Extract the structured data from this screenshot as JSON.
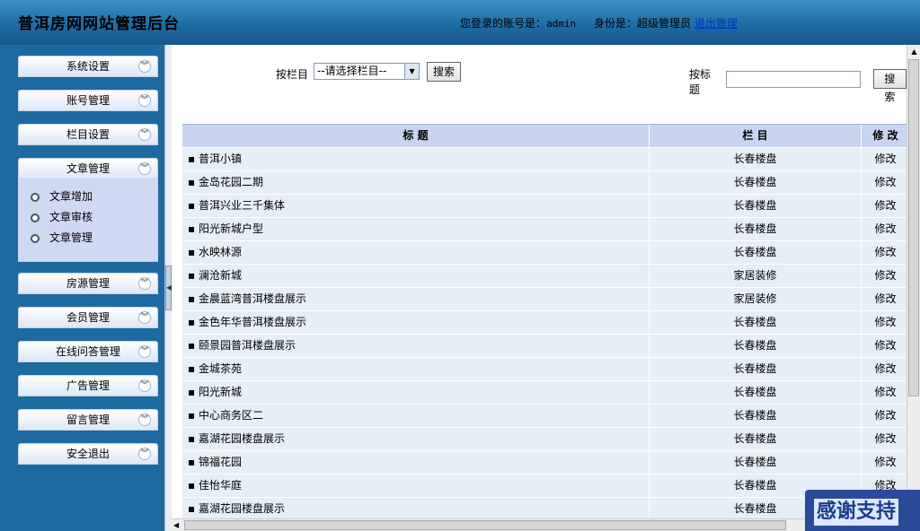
{
  "header": {
    "title": "普洱房网网站管理后台",
    "login_prefix": "您登录的账号是：",
    "account": "admin",
    "role_prefix": "身份是：",
    "role": "超级管理员",
    "logout_link": "退出管理"
  },
  "sidebar": {
    "menus": [
      {
        "label": "系统设置"
      },
      {
        "label": "账号管理"
      },
      {
        "label": "栏目设置"
      },
      {
        "label": "文章管理",
        "expanded": true,
        "items": [
          "文章增加",
          "文章审核",
          "文章管理"
        ]
      },
      {
        "label": "房源管理"
      },
      {
        "label": "会员管理"
      },
      {
        "label": "在线问答管理"
      },
      {
        "label": "广告管理"
      },
      {
        "label": "留言管理"
      },
      {
        "label": "安全退出"
      }
    ]
  },
  "search": {
    "category_label": "按栏目",
    "category_selected": "--请选择栏目--",
    "category_button": "搜索",
    "title_label": "按标题",
    "title_value": "",
    "title_button": "搜索"
  },
  "table": {
    "headers": [
      "标 题",
      "栏 目",
      "修 改"
    ],
    "rows": [
      {
        "title": "普洱小镇",
        "category": "长春楼盘",
        "action": "修改"
      },
      {
        "title": "金岛花园二期",
        "category": "长春楼盘",
        "action": "修改"
      },
      {
        "title": "普洱兴业三千集体",
        "category": "长春楼盘",
        "action": "修改"
      },
      {
        "title": "阳光新城户型",
        "category": "长春楼盘",
        "action": "修改"
      },
      {
        "title": "水映林源",
        "category": "长春楼盘",
        "action": "修改"
      },
      {
        "title": "澜沧新城",
        "category": "家居装修",
        "action": "修改"
      },
      {
        "title": "金晨蓝湾普洱楼盘展示",
        "category": "家居装修",
        "action": "修改"
      },
      {
        "title": "金色年华普洱楼盘展示",
        "category": "长春楼盘",
        "action": "修改"
      },
      {
        "title": "颐景园普洱楼盘展示",
        "category": "长春楼盘",
        "action": "修改"
      },
      {
        "title": "金城茶苑",
        "category": "长春楼盘",
        "action": "修改"
      },
      {
        "title": "阳光新城",
        "category": "长春楼盘",
        "action": "修改"
      },
      {
        "title": "中心商务区二",
        "category": "长春楼盘",
        "action": "修改"
      },
      {
        "title": "嘉湖花园楼盘展示",
        "category": "长春楼盘",
        "action": "修改"
      },
      {
        "title": "锦福花园",
        "category": "长春楼盘",
        "action": "修改"
      },
      {
        "title": "佳怡华庭",
        "category": "长春楼盘",
        "action": "修改"
      },
      {
        "title": "嘉湖花园楼盘展示",
        "category": "长春楼盘",
        "action": "修改"
      }
    ]
  },
  "badge": "感谢支持"
}
